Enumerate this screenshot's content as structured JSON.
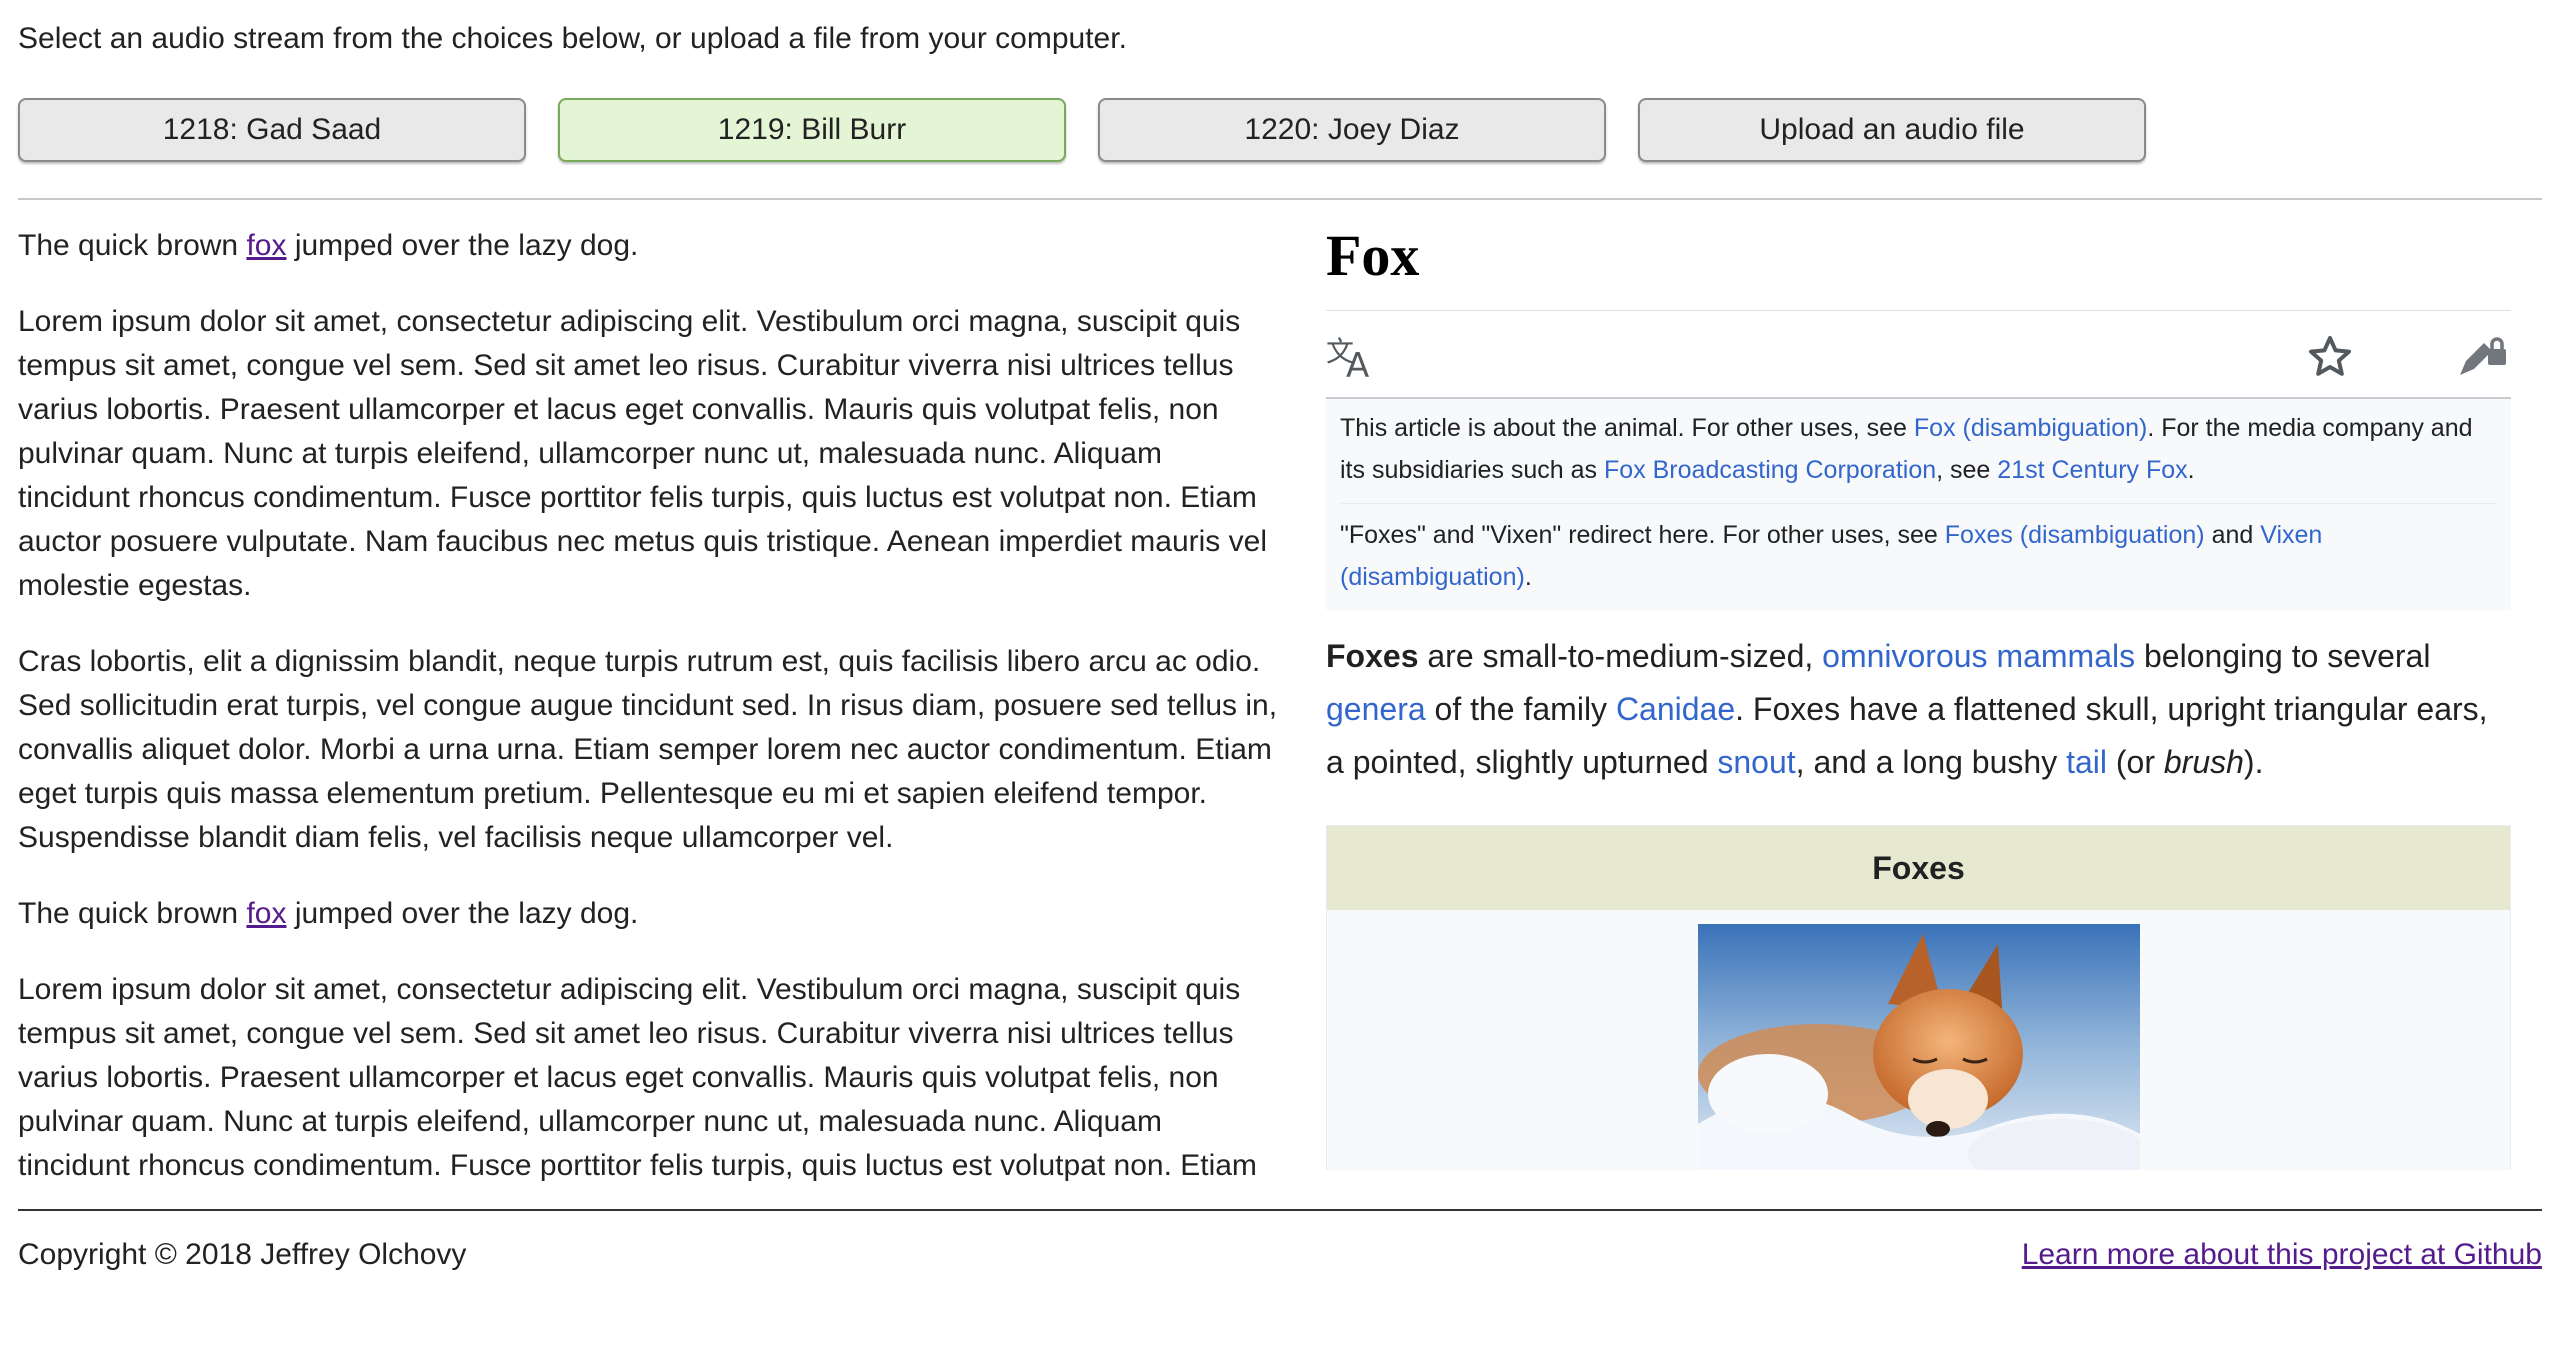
{
  "intro": "Select an audio stream from the choices below, or upload a file from your computer.",
  "buttons": [
    {
      "label": "1218: Gad Saad"
    },
    {
      "label": "1219: Bill Burr"
    },
    {
      "label": "1220: Joey Diaz"
    },
    {
      "label": "Upload an audio file"
    }
  ],
  "active_button": "1219: Bill Burr",
  "colors": {
    "active_button_bg": "#e4f5d6",
    "link_visited": "#551a8b",
    "wiki_link": "#3366cc"
  },
  "transcript": {
    "p1": {
      "before": "The quick brown ",
      "link": "fox",
      "after": " jumped over the lazy dog."
    },
    "p2": "Lorem ipsum dolor sit amet, consectetur adipiscing elit. Vestibulum orci magna, suscipit quis tempus sit amet, congue vel sem. Sed sit amet leo risus. Curabitur viverra nisi ultrices tellus varius lobortis. Praesent ullamcorper et lacus eget convallis. Mauris quis volutpat felis, non pulvinar quam. Nunc at turpis eleifend, ullamcorper nunc ut, malesuada nunc. Aliquam tincidunt rhoncus condimentum. Fusce porttitor felis turpis, quis luctus est volutpat non. Etiam auctor posuere vulputate. Nam faucibus nec metus quis tristique. Aenean imperdiet mauris vel molestie egestas.",
    "p3": "Cras lobortis, elit a dignissim blandit, neque turpis rutrum est, quis facilisis libero arcu ac odio. Sed sollicitudin erat turpis, vel congue augue tincidunt sed. In risus diam, posuere sed tellus in, convallis aliquet dolor. Morbi a urna urna. Etiam semper lorem nec auctor condimentum. Etiam eget turpis quis massa elementum pretium. Pellentesque eu mi et sapien eleifend tempor. Suspendisse blandit diam felis, vel facilisis neque ullamcorper vel.",
    "p4": {
      "before": "The quick brown ",
      "link": "fox",
      "after": " jumped over the lazy dog."
    },
    "p5": "Lorem ipsum dolor sit amet, consectetur adipiscing elit. Vestibulum orci magna, suscipit quis tempus sit amet, congue vel sem. Sed sit amet leo risus. Curabitur viverra nisi ultrices tellus varius lobortis. Praesent ullamcorper et lacus eget convallis. Mauris quis volutpat felis, non pulvinar quam. Nunc at turpis eleifend, ullamcorper nunc ut, malesuada nunc. Aliquam tincidunt rhoncus condimentum. Fusce porttitor felis turpis, quis luctus est volutpat non. Etiam"
  },
  "wiki": {
    "title": "Fox",
    "toolbar_icons": [
      "translate-icon",
      "star-icon",
      "edit-lock-icon"
    ],
    "hatnote1": {
      "t1": "This article is about the animal. For other uses, see ",
      "l1": "Fox (disambiguation)",
      "t2": ". For the media company and its subsidiaries such as ",
      "l2": "Fox Broadcasting Corporation",
      "t3": ", see ",
      "l3": "21st Century Fox",
      "t4": "."
    },
    "hatnote2": {
      "t1": "\"Foxes\" and \"Vixen\" redirect here. For other uses, see ",
      "l1": "Foxes (disambiguation)",
      "t2": " and ",
      "l2": "Vixen (disambiguation)",
      "t3": "."
    },
    "lead": {
      "b1": "Foxes",
      "t1": " are small-to-medium-sized, ",
      "l1": "omnivorous mammals",
      "t2": " belonging to several ",
      "l2": "genera",
      "t3": " of the family ",
      "l3": "Canidae",
      "t4": ". Foxes have a flattened skull, upright triangular ears, a pointed, slightly upturned ",
      "l4": "snout",
      "t5": ", and a long bushy ",
      "l5": "tail",
      "t6": " (or ",
      "i1": "brush",
      "t7": ")."
    },
    "infobox_title": "Foxes"
  },
  "footer": {
    "copyright": "Copyright © 2018 Jeffrey Olchovy",
    "github": "Learn more about this project at Github"
  }
}
